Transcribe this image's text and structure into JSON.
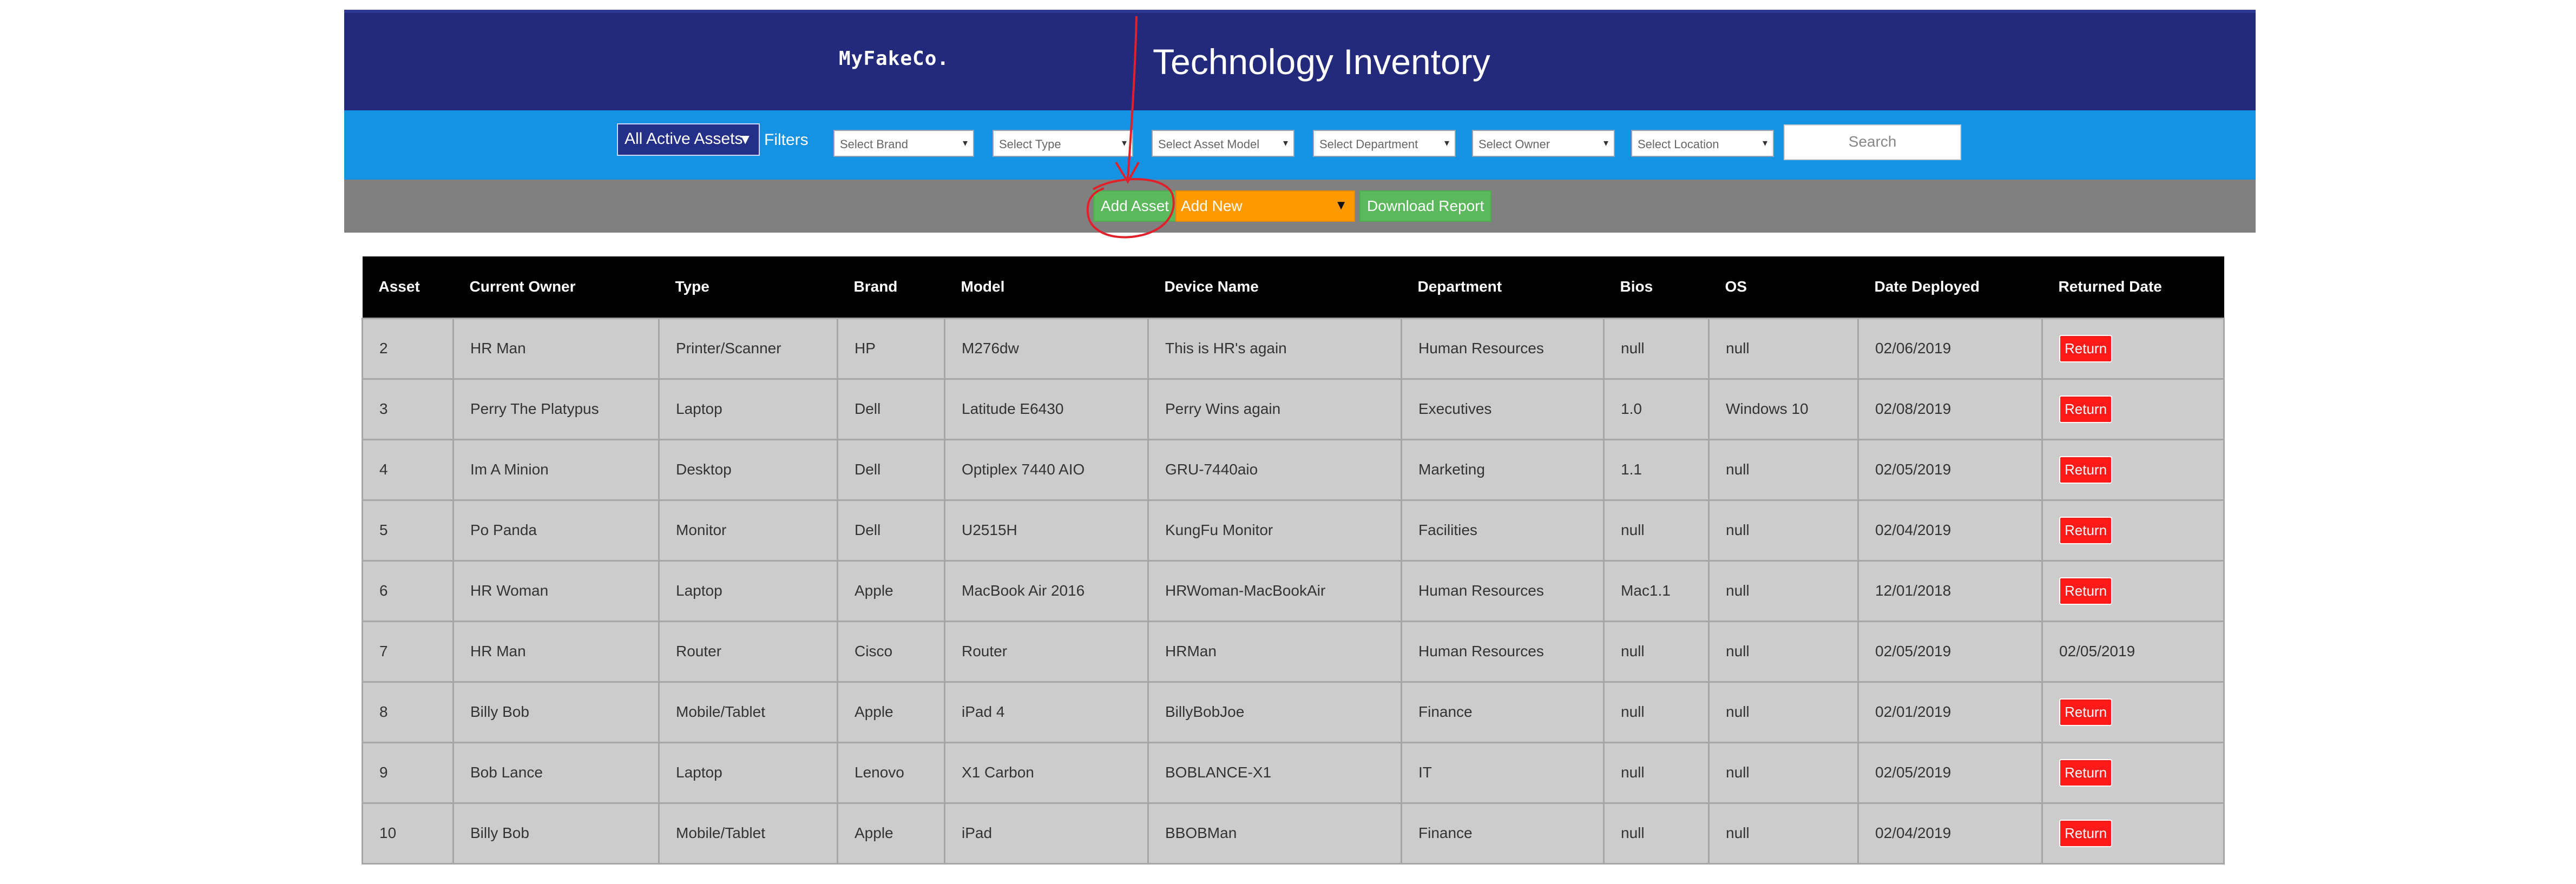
{
  "header": {
    "logo": "MyFakeCo.",
    "title": "Technology Inventory"
  },
  "filterbar": {
    "scope_value": "All Active Assets",
    "filters_label": "Filters",
    "selects": [
      "Select Brand",
      "Select Type",
      "Select Asset Model",
      "Select Department",
      "Select Owner",
      "Select Location"
    ],
    "search_placeholder": "Search"
  },
  "actions": {
    "add_asset": "Add Asset",
    "add_new": "Add New",
    "download_report": "Download Report"
  },
  "annotation_color": "#e0202a",
  "table": {
    "columns": [
      "Asset",
      "Current Owner",
      "Type",
      "Brand",
      "Model",
      "Device Name",
      "Department",
      "Bios",
      "OS",
      "Date Deployed",
      "Returned Date"
    ],
    "return_label": "Return",
    "rows": [
      {
        "asset": "2",
        "owner": "HR Man",
        "type": "Printer/Scanner",
        "brand": "HP",
        "model": "M276dw",
        "device": "This is HR's again",
        "dept": "Human Resources",
        "bios": "null",
        "os": "null",
        "deployed": "02/06/2019",
        "returned": ""
      },
      {
        "asset": "3",
        "owner": "Perry The Platypus",
        "type": "Laptop",
        "brand": "Dell",
        "model": "Latitude E6430",
        "device": "Perry Wins again",
        "dept": "Executives",
        "bios": "1.0",
        "os": "Windows 10",
        "deployed": "02/08/2019",
        "returned": ""
      },
      {
        "asset": "4",
        "owner": "Im A Minion",
        "type": "Desktop",
        "brand": "Dell",
        "model": "Optiplex 7440 AIO",
        "device": "GRU-7440aio",
        "dept": "Marketing",
        "bios": "1.1",
        "os": "null",
        "deployed": "02/05/2019",
        "returned": ""
      },
      {
        "asset": "5",
        "owner": "Po Panda",
        "type": "Monitor",
        "brand": "Dell",
        "model": "U2515H",
        "device": "KungFu Monitor",
        "dept": "Facilities",
        "bios": "null",
        "os": "null",
        "deployed": "02/04/2019",
        "returned": ""
      },
      {
        "asset": "6",
        "owner": "HR Woman",
        "type": "Laptop",
        "brand": "Apple",
        "model": "MacBook Air 2016",
        "device": "HRWoman-MacBookAir",
        "dept": "Human Resources",
        "bios": "Mac1.1",
        "os": "null",
        "deployed": "12/01/2018",
        "returned": ""
      },
      {
        "asset": "7",
        "owner": "HR Man",
        "type": "Router",
        "brand": "Cisco",
        "model": "Router",
        "device": "HRMan",
        "dept": "Human Resources",
        "bios": "null",
        "os": "null",
        "deployed": "02/05/2019",
        "returned": "02/05/2019"
      },
      {
        "asset": "8",
        "owner": "Billy Bob",
        "type": "Mobile/Tablet",
        "brand": "Apple",
        "model": "iPad 4",
        "device": "BillyBobJoe",
        "dept": "Finance",
        "bios": "null",
        "os": "null",
        "deployed": "02/01/2019",
        "returned": ""
      },
      {
        "asset": "9",
        "owner": "Bob Lance",
        "type": "Laptop",
        "brand": "Lenovo",
        "model": "X1 Carbon",
        "device": "BOBLANCE-X1",
        "dept": "IT",
        "bios": "null",
        "os": "null",
        "deployed": "02/05/2019",
        "returned": ""
      },
      {
        "asset": "10",
        "owner": "Billy Bob",
        "type": "Mobile/Tablet",
        "brand": "Apple",
        "model": "iPad",
        "device": "BBOBMan",
        "dept": "Finance",
        "bios": "null",
        "os": "null",
        "deployed": "02/04/2019",
        "returned": ""
      }
    ]
  }
}
